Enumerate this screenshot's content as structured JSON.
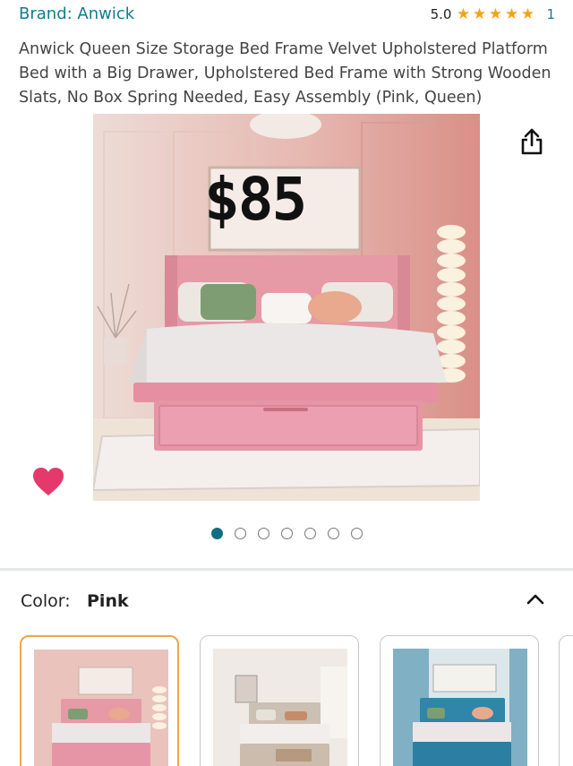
{
  "brand": {
    "link_text": "Brand: Anwick"
  },
  "rating": {
    "value": "5.0",
    "count": "1",
    "stars": 5
  },
  "product": {
    "title": "Anwick Queen Size Storage Bed Frame Velvet Upholstered Platform Bed with a Big Drawer, Upholstered Bed Frame with Strong Wooden Slats, No Box Spring Needed, Easy Assembly (Pink, Queen)",
    "price_overlay": "$85"
  },
  "carousel": {
    "total": 7,
    "active_index": 0
  },
  "color_selector": {
    "label": "Color:",
    "selected": "Pink"
  },
  "swatches": [
    {
      "name": "Pink",
      "selected": true
    },
    {
      "name": "Beige",
      "selected": false
    },
    {
      "name": "Blue",
      "selected": false
    }
  ],
  "colors": {
    "link": "#0f7d8f",
    "star": "#f2a31b",
    "heart": "#e5396b",
    "active_dot": "#0f6f82",
    "selected_border": "#f0a64a"
  }
}
